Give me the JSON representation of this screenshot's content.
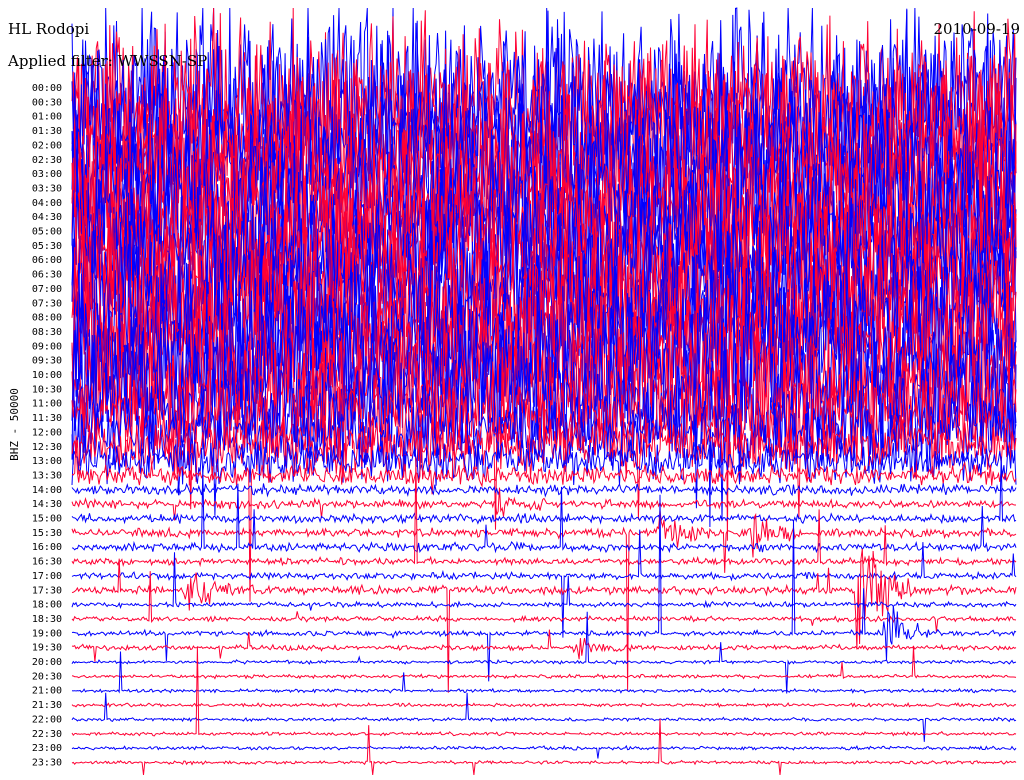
{
  "header": {
    "station": "HL Rodopi",
    "filter": "Applied filter: WWSSN-SP",
    "date": "2010-09-19"
  },
  "chart_data": {
    "type": "line",
    "title": "HL Rodopi",
    "subtitle": "Applied filter: WWSSN-SP",
    "date": "2010-09-19",
    "ylabel": "BHZ - 50000",
    "row_interval_minutes": 30,
    "row_labels": [
      "00:00",
      "00:30",
      "01:00",
      "01:30",
      "02:00",
      "02:30",
      "03:00",
      "03:30",
      "04:00",
      "04:30",
      "05:00",
      "05:30",
      "06:00",
      "06:30",
      "07:00",
      "07:30",
      "08:00",
      "08:30",
      "09:00",
      "09:30",
      "10:00",
      "10:30",
      "11:00",
      "11:30",
      "12:00",
      "12:30",
      "13:00",
      "13:30",
      "14:00",
      "14:30",
      "15:00",
      "15:30",
      "16:00",
      "16:30",
      "17:00",
      "17:30",
      "18:00",
      "18:30",
      "19:00",
      "19:30",
      "20:00",
      "20:30",
      "21:00",
      "21:30",
      "22:00",
      "22:30",
      "23:00",
      "23:30"
    ],
    "series_colors": [
      "#0000ff",
      "#ff0033"
    ],
    "row_amplitude_relative": [
      1.0,
      1.0,
      1.0,
      1.0,
      1.0,
      1.0,
      1.0,
      1.0,
      1.0,
      1.0,
      1.0,
      1.0,
      1.0,
      1.0,
      1.0,
      1.0,
      1.0,
      1.0,
      1.0,
      1.0,
      1.0,
      0.9,
      0.8,
      0.55,
      0.45,
      0.35,
      0.25,
      0.12,
      0.06,
      0.05,
      0.05,
      0.05,
      0.05,
      0.04,
      0.04,
      0.05,
      0.03,
      0.03,
      0.03,
      0.03,
      0.02,
      0.02,
      0.02,
      0.02,
      0.02,
      0.02,
      0.02,
      0.02
    ],
    "events": [
      {
        "time": "14:30",
        "position": 0.45,
        "amplitude_relative": 0.3
      },
      {
        "time": "15:30",
        "position": 0.62,
        "amplitude_relative": 0.5
      },
      {
        "time": "15:30",
        "position": 0.72,
        "amplitude_relative": 0.4
      },
      {
        "time": "17:30",
        "position": 0.12,
        "amplitude_relative": 0.5
      },
      {
        "time": "17:30",
        "position": 0.83,
        "amplitude_relative": 2.0
      },
      {
        "time": "19:00",
        "position": 0.86,
        "amplitude_relative": 0.8
      },
      {
        "time": "19:30",
        "position": 0.53,
        "amplitude_relative": 0.3
      }
    ]
  }
}
